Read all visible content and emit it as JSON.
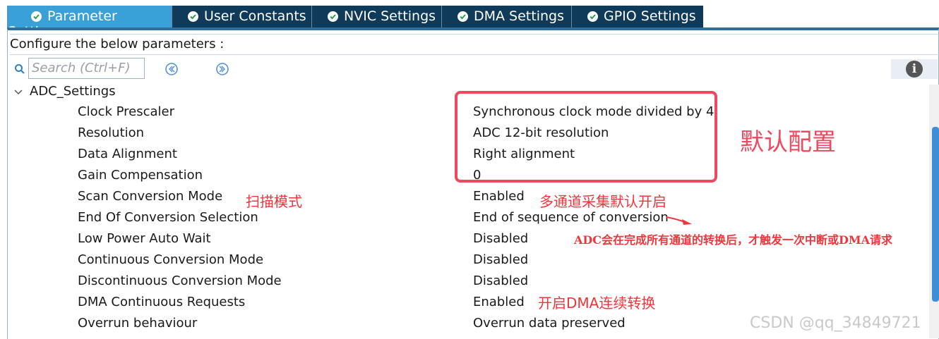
{
  "tabs": [
    {
      "label": "Parameter Settings",
      "active": true
    },
    {
      "label": "User Constants",
      "active": false
    },
    {
      "label": "NVIC Settings",
      "active": false
    },
    {
      "label": "DMA Settings",
      "active": false
    },
    {
      "label": "GPIO Settings",
      "active": false
    }
  ],
  "configure_text": "Configure the below parameters :",
  "search": {
    "placeholder": "Search (Ctrl+F)"
  },
  "group": {
    "label": "ADC_Settings",
    "expanded": true
  },
  "params": [
    {
      "name": "Clock Prescaler",
      "value": "Synchronous clock mode divided by 4"
    },
    {
      "name": "Resolution",
      "value": "ADC 12-bit resolution"
    },
    {
      "name": "Data Alignment",
      "value": "Right alignment"
    },
    {
      "name": "Gain Compensation",
      "value": "0"
    },
    {
      "name": "Scan Conversion Mode",
      "value": "Enabled"
    },
    {
      "name": "End Of Conversion Selection",
      "value": "End of sequence of conversion"
    },
    {
      "name": "Low Power Auto Wait",
      "value": "Disabled"
    },
    {
      "name": "Continuous Conversion Mode",
      "value": "Disabled"
    },
    {
      "name": "Discontinuous Conversion Mode",
      "value": "Disabled"
    },
    {
      "name": "DMA Continuous Requests",
      "value": "Enabled"
    },
    {
      "name": "Overrun behaviour",
      "value": "Overrun data preserved"
    }
  ],
  "annotations": {
    "default_config": "默认配置",
    "scan_mode": "扫描模式",
    "multi_channel": "多通道采集默认开启",
    "eoc_note": "ADC会在完成所有通道的转换后，才触发一次中断或DMA请求",
    "dma_continuous": "开启DMA连续转换"
  },
  "watermark": "CSDN @qq_34849721",
  "colors": {
    "tab_active": "#3aa0d8",
    "tab_inactive": "#0f3a5a",
    "annotation_red": "#f0485e",
    "scroll_thumb": "#3a8fd6"
  }
}
